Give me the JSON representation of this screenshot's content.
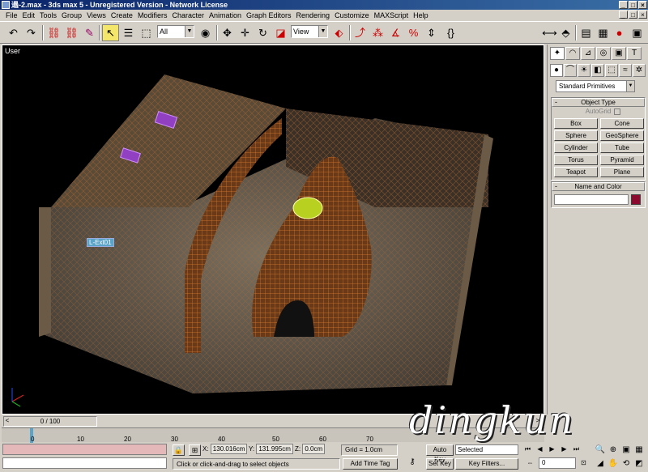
{
  "window": {
    "title": "遢-2.max - 3ds max 5 - Unregistered Version - Network License",
    "controls": [
      "_",
      "□",
      "×"
    ]
  },
  "menu": {
    "items": [
      "File",
      "Edit",
      "Tools",
      "Group",
      "Views",
      "Create",
      "Modifiers",
      "Character",
      "Animation",
      "Graph Editors",
      "Rendering",
      "Customize",
      "MAXScript",
      "Help"
    ]
  },
  "toolbar": {
    "selection_filter": "All",
    "ref_coord_system": "View"
  },
  "viewport": {
    "label": "User",
    "object_label": "L-Ext01"
  },
  "command_panel": {
    "dropdown": "Standard Primitives",
    "object_type_header": "Object Type",
    "autogrid_label": "AutoGrid",
    "object_buttons": [
      "Box",
      "Cone",
      "Sphere",
      "GeoSphere",
      "Cylinder",
      "Tube",
      "Torus",
      "Pyramid",
      "Teapot",
      "Plane"
    ],
    "name_color_header": "Name and Color",
    "swatch_color": "#8b0a2e"
  },
  "time_slider": {
    "position": "0 / 100",
    "prev": "<",
    "next": ">"
  },
  "track_bar": {
    "ticks": [
      "0",
      "10",
      "20",
      "30",
      "40",
      "50",
      "60",
      "70"
    ]
  },
  "status": {
    "x_label": "X:",
    "x_value": "130.016cm",
    "y_label": "Y:",
    "y_value": "131.995cm",
    "z_label": "Z:",
    "z_value": "0.0cm",
    "grid": "Grid = 1.0cm",
    "prompt": "Click or click-and-drag to select objects",
    "add_time_tag": "Add Time Tag",
    "auto_key": "Auto Key",
    "set_key": "Set Key",
    "selection_set": "Selected",
    "key_filters": "Key Filters...",
    "frame": "0"
  },
  "watermark": "dingkun"
}
